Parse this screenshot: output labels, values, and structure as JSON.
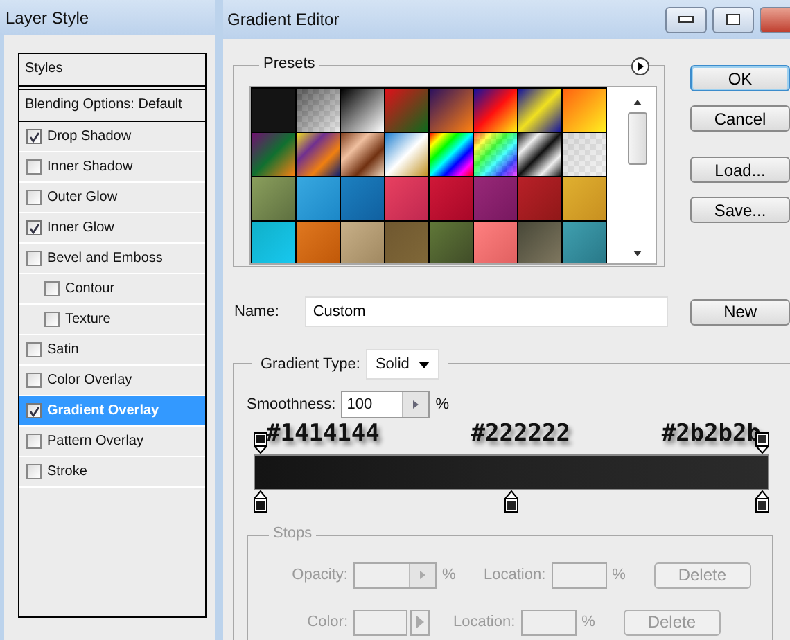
{
  "layer_style": {
    "title": "Layer Style",
    "header": "Styles",
    "blending": "Blending Options: Default",
    "items": [
      {
        "label": "Drop Shadow",
        "checked": true,
        "selected": false
      },
      {
        "label": "Inner Shadow",
        "checked": false,
        "selected": false
      },
      {
        "label": "Outer Glow",
        "checked": false,
        "selected": false
      },
      {
        "label": "Inner Glow",
        "checked": true,
        "selected": false
      },
      {
        "label": "Bevel and Emboss",
        "checked": false,
        "selected": false,
        "children": [
          {
            "label": "Contour",
            "checked": false,
            "selected": false
          },
          {
            "label": "Texture",
            "checked": false,
            "selected": false
          }
        ]
      },
      {
        "label": "Satin",
        "checked": false,
        "selected": false
      },
      {
        "label": "Color Overlay",
        "checked": false,
        "selected": false
      },
      {
        "label": "Gradient Overlay",
        "checked": true,
        "selected": true
      },
      {
        "label": "Pattern Overlay",
        "checked": false,
        "selected": false
      },
      {
        "label": "Stroke",
        "checked": false,
        "selected": false
      }
    ]
  },
  "gradient_editor": {
    "title": "Gradient Editor",
    "presets": {
      "label": "Presets"
    },
    "buttons": [
      "OK",
      "Cancel",
      "Load...",
      "Save..."
    ],
    "name_label": "Name:",
    "name_value": "Custom",
    "new_button": "New",
    "gradient_type_label": "Gradient Type:",
    "gradient_type": "Solid",
    "smoothness_label": "Smoothness:",
    "smoothness": "100",
    "percent": "%",
    "annotations": [
      "#1414144",
      "#222222",
      "#2b2b2b"
    ],
    "opacity_stops": [
      {
        "color": "#141414"
      },
      {
        "color": "#2b2b2b"
      }
    ],
    "color_stops": [
      {
        "color": "#141414"
      },
      {
        "color": "#222222"
      },
      {
        "color": "#2b2b2b"
      }
    ],
    "stops": {
      "label": "Stops",
      "disabled": true,
      "rows": [
        {
          "kind": "opacity",
          "label": "Opacity:",
          "percent": "%",
          "location_label": "Location:",
          "location_percent": "%",
          "delete": "Delete"
        },
        {
          "kind": "color",
          "label": "Color:",
          "location_label": "Location:",
          "location_percent": "%",
          "delete": "Delete"
        }
      ]
    }
  }
}
